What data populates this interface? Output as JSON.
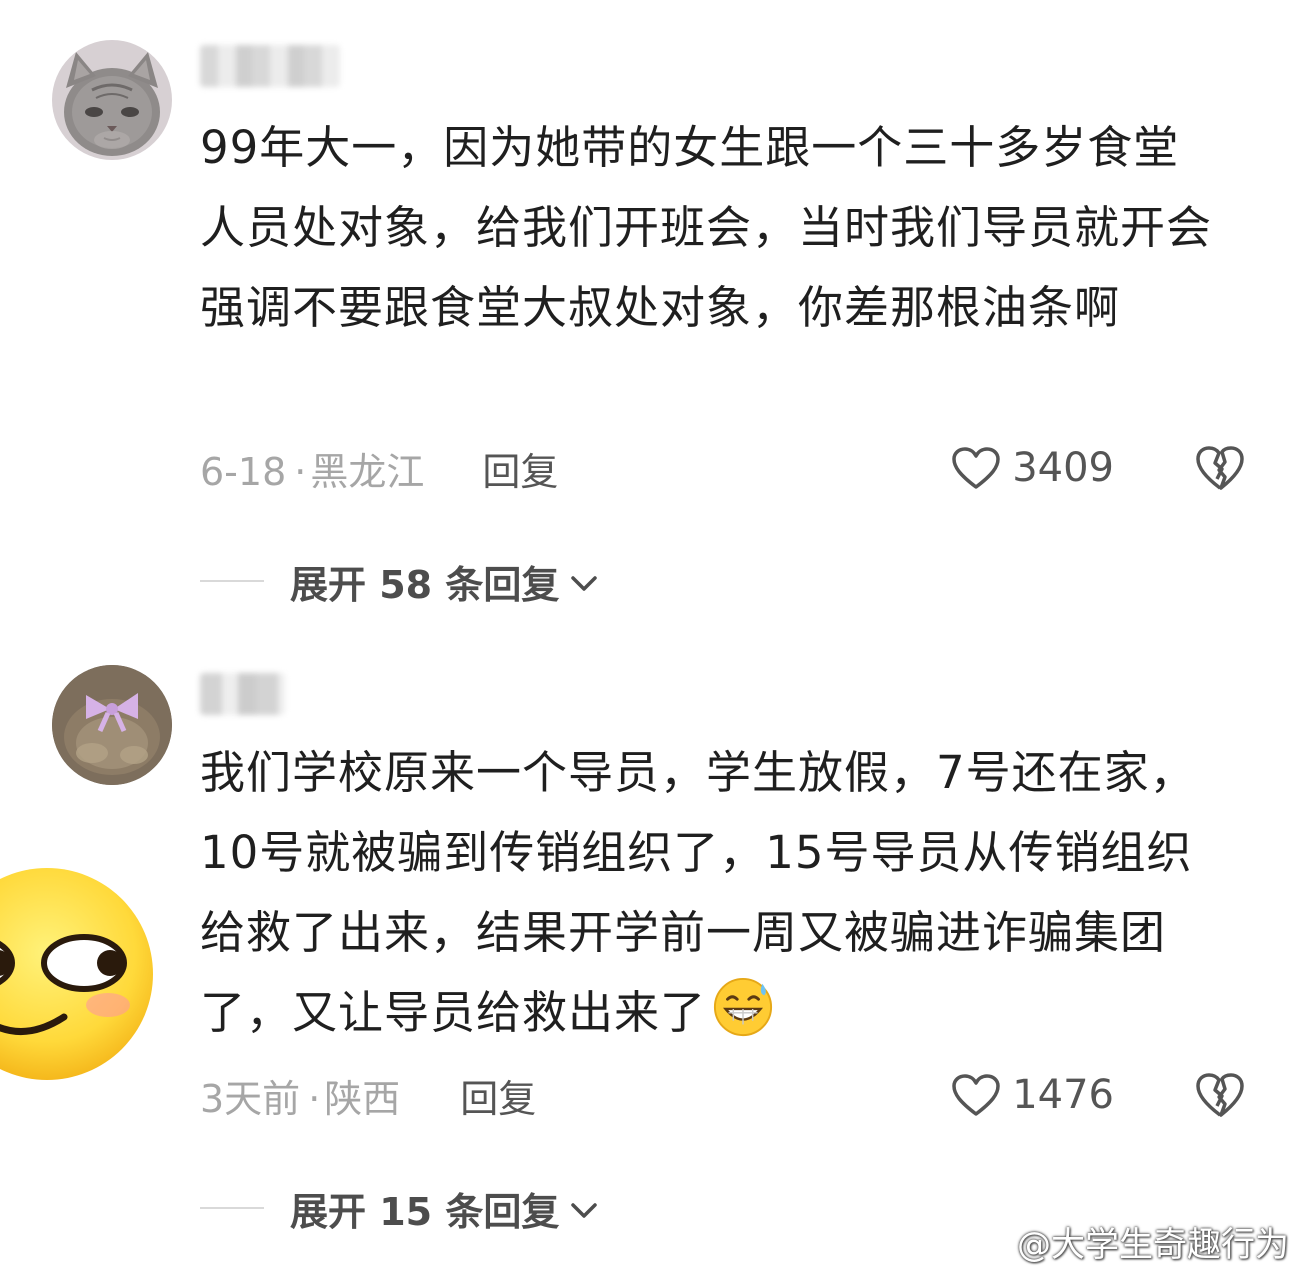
{
  "comments": [
    {
      "text": "99年大一，因为她带的女生跟一个三十多岁食堂人员处对象，给我们开班会，当时我们导员就开会强调不要跟食堂大叔处对象，你差那根油条啊",
      "date": "6-18",
      "separator": "·",
      "location": "黑龙江",
      "reply_label": "回复",
      "likes": "3409",
      "expand_label": "展开 58 条回复",
      "avatar_icon": "gray-cat-avatar",
      "username_blurred": true
    },
    {
      "text": "我们学校原来一个导员，学生放假，7号还在家，10号就被骗到传销组织了，15号导员从传销组织给救了出来，结果开学前一周又被骗进诈骗集团了，又让导员给救出来了",
      "emoji": "grinning-sweat-emoji",
      "date": "3天前",
      "separator": "·",
      "location": "陕西",
      "reply_label": "回复",
      "likes": "1476",
      "expand_label": "展开 15 条回复",
      "avatar_icon": "bow-avatar",
      "username_blurred": true
    }
  ],
  "sticker": {
    "icon": "smirk-face-sticker"
  },
  "watermark": {
    "icon": "weibo-icon",
    "text": "@大学生奇趣行为"
  },
  "colors": {
    "text": "#1f1f1f",
    "meta": "#a6a6a6",
    "action": "#555555",
    "expand": "#4d4d4d",
    "divider": "#d9d9d9"
  }
}
